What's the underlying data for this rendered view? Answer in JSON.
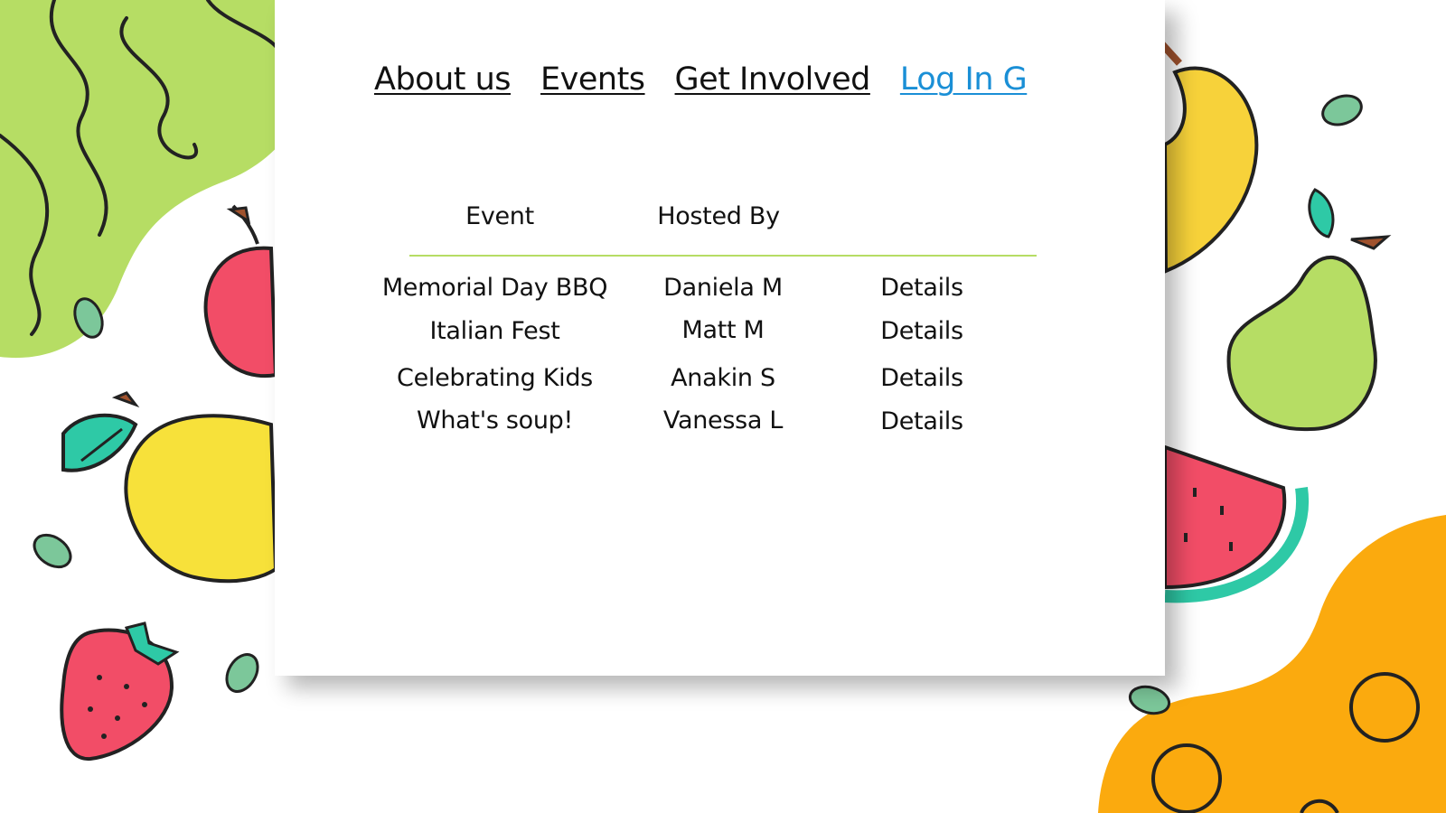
{
  "nav": {
    "about": "About us",
    "events": "Events",
    "get_involved": "Get Involved",
    "login": "Log In G"
  },
  "table": {
    "headers": [
      "Event",
      "Hosted By"
    ],
    "rows": [
      {
        "event": "Memorial Day BBQ",
        "host": "Daniela M",
        "action": "Details"
      },
      {
        "event": "Italian Fest",
        "host": "Matt M",
        "action": "Details"
      },
      {
        "event": "Celebrating Kids",
        "host": "Anakin S",
        "action": "Details"
      },
      {
        "event": "What's soup!",
        "host": "Vanessa L",
        "action": "Details"
      }
    ]
  },
  "colors": {
    "accent_green": "#b6dd64",
    "link_blue": "#1a8fd6",
    "blob_orange": "#fbaa0e"
  },
  "decorations": [
    "apple-icon",
    "lemon-icon",
    "strawberry-icon",
    "banana-icon",
    "pear-icon",
    "watermelon-icon",
    "leaf-icon"
  ]
}
